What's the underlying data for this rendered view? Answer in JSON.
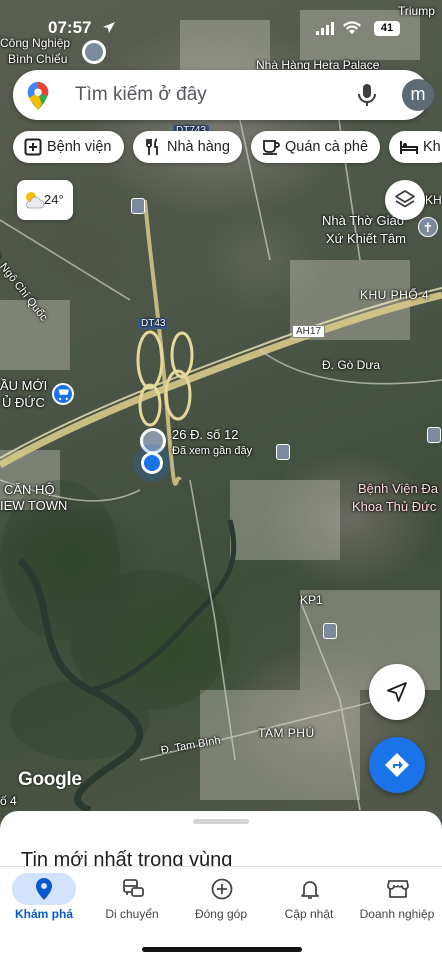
{
  "status_bar": {
    "time": "07:57",
    "battery": "41"
  },
  "search": {
    "placeholder": "Tìm kiếm ở đây",
    "avatar_letter": "m"
  },
  "chips": [
    {
      "label": "Bệnh viện",
      "icon": "hospital-icon"
    },
    {
      "label": "Nhà hàng",
      "icon": "restaurant-icon"
    },
    {
      "label": "Quán cà phê",
      "icon": "coffee-icon"
    },
    {
      "label": "Kh",
      "icon": "hotel-icon"
    }
  ],
  "weather": {
    "temperature": "24°",
    "icon": "partly-cloudy-icon"
  },
  "map": {
    "labels": {
      "cong_nghiep_1": "Công Nghiệp",
      "cong_nghiep_2": "Bình Chiểu",
      "hera": "Nhà Hàng Hera Palace",
      "triump": "Triump",
      "dt743": "DT743",
      "ngo_chi_quoc": "Đ. Ngô Chí Quốc",
      "tho_1": "Nhà Thờ Giáo",
      "tho_2": "Xứ Khiết Tâm",
      "kh": "KH",
      "khu_pho": "KHU PHỐ 4",
      "dt43": "DT43",
      "ah17": "AH17",
      "go_dua": "Đ. Gò Dưa",
      "au_moi_1": "ẦU MỚI",
      "au_moi_2": "Ủ ĐỨC",
      "pin_1": "26 Đ. số 12",
      "pin_2": "Đã xem gần đây",
      "can_ho_1": "CĂN HỘ",
      "can_ho_2": "IEW TOWN",
      "bv_1": "Bệnh Viện Đa",
      "bv_2": "Khoa Thủ Đức",
      "kp1": "KP1",
      "tam_phu": "TAM PHÚ",
      "tam_binh": "Đ. Tam Bình",
      "so4": "ố 4"
    },
    "attribution": "Google"
  },
  "sheet": {
    "title": "Tin mới nhất trong vùng"
  },
  "bottom_nav": [
    {
      "label": "Khám phá",
      "icon": "explore-pin-icon",
      "active": true
    },
    {
      "label": "Di chuyển",
      "icon": "commute-icon",
      "active": false
    },
    {
      "label": "Đóng góp",
      "icon": "contribute-plus-icon",
      "active": false
    },
    {
      "label": "Cập nhật",
      "icon": "notifications-bell-icon",
      "active": false
    },
    {
      "label": "Doanh nghiệp",
      "icon": "business-store-icon",
      "active": false
    }
  ]
}
